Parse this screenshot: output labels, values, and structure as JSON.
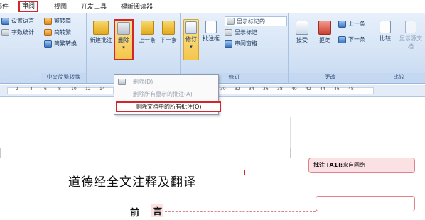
{
  "tabs": [
    {
      "label": "邮件",
      "active": false
    },
    {
      "label": "审阅",
      "active": true
    },
    {
      "label": "视图",
      "active": false
    },
    {
      "label": "开发工具",
      "active": false
    },
    {
      "label": "福昕阅读器",
      "active": false
    }
  ],
  "ribbon": {
    "proofing": {
      "set_language": "设置语言",
      "word_count": "字数统计"
    },
    "chinese": {
      "to_simplified": "繁转简",
      "to_traditional": "简转繁",
      "convert": "简繁转换",
      "group_label": "中文简繁转换"
    },
    "comments": {
      "new_comment": "新建批注",
      "delete": "删除",
      "previous": "上一条",
      "next": "下一条"
    },
    "tracking": {
      "track_changes": "修订",
      "balloons": "批注框",
      "display_markup": "显示标记的...",
      "show_markup": "显示标记",
      "reviewing_pane": "审阅窗格",
      "group_label": "修订"
    },
    "changes": {
      "accept": "接受",
      "reject": "拒绝",
      "previous": "上一条",
      "next": "下一条",
      "group_label": "更改"
    },
    "compare": {
      "compare": "比较",
      "show_source": "显示源文档",
      "group_label": "比较"
    }
  },
  "delete_menu": {
    "items": [
      {
        "label": "删除(D)",
        "enabled": false
      },
      {
        "label": "删除所有显示的批注(A)",
        "enabled": false
      },
      {
        "label": "删除文档中的所有批注(O)",
        "enabled": true
      }
    ]
  },
  "ruler": {
    "left_ticks": [
      "2",
      "4",
      "6",
      "8",
      "10",
      "12",
      "14"
    ],
    "right_ticks": [
      "30",
      "32",
      "34",
      "36",
      "38",
      "40",
      "42",
      "44",
      "46",
      "48"
    ]
  },
  "document": {
    "title": "道德经全文注释及翻译",
    "preface_1": "前",
    "preface_2": "言",
    "comment_label": "批注 [A1]:",
    "comment_text": "来自网络"
  },
  "colors": {
    "highlight_border": "#d3262c",
    "ribbon_bg": "#d4e3f5",
    "comment_fill": "#fbe1e3"
  }
}
